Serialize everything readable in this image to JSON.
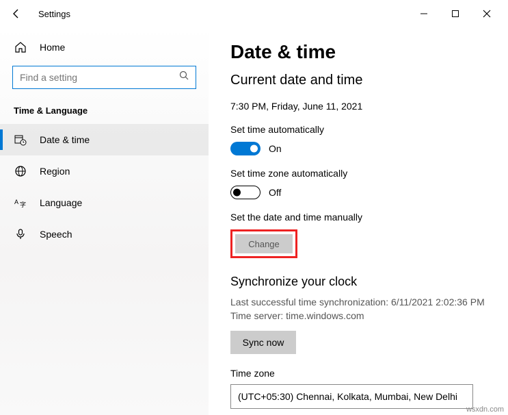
{
  "titlebar": {
    "title": "Settings"
  },
  "sidebar": {
    "home": "Home",
    "search_placeholder": "Find a setting",
    "section": "Time & Language",
    "items": [
      {
        "label": "Date & time"
      },
      {
        "label": "Region"
      },
      {
        "label": "Language"
      },
      {
        "label": "Speech"
      }
    ]
  },
  "main": {
    "title": "Date & time",
    "subtitle": "Current date and time",
    "datetime": "7:30 PM, Friday, June 11, 2021",
    "auto_time_label": "Set time automatically",
    "auto_time_state": "On",
    "auto_tz_label": "Set time zone automatically",
    "auto_tz_state": "Off",
    "manual_label": "Set the date and time manually",
    "change_btn": "Change",
    "sync_title": "Synchronize your clock",
    "sync_last": "Last successful time synchronization: 6/11/2021 2:02:36 PM",
    "sync_server": "Time server: time.windows.com",
    "sync_btn": "Sync now",
    "tz_label": "Time zone",
    "tz_value": "(UTC+05:30) Chennai, Kolkata, Mumbai, New Delhi"
  },
  "watermark": "wsxdn.com"
}
